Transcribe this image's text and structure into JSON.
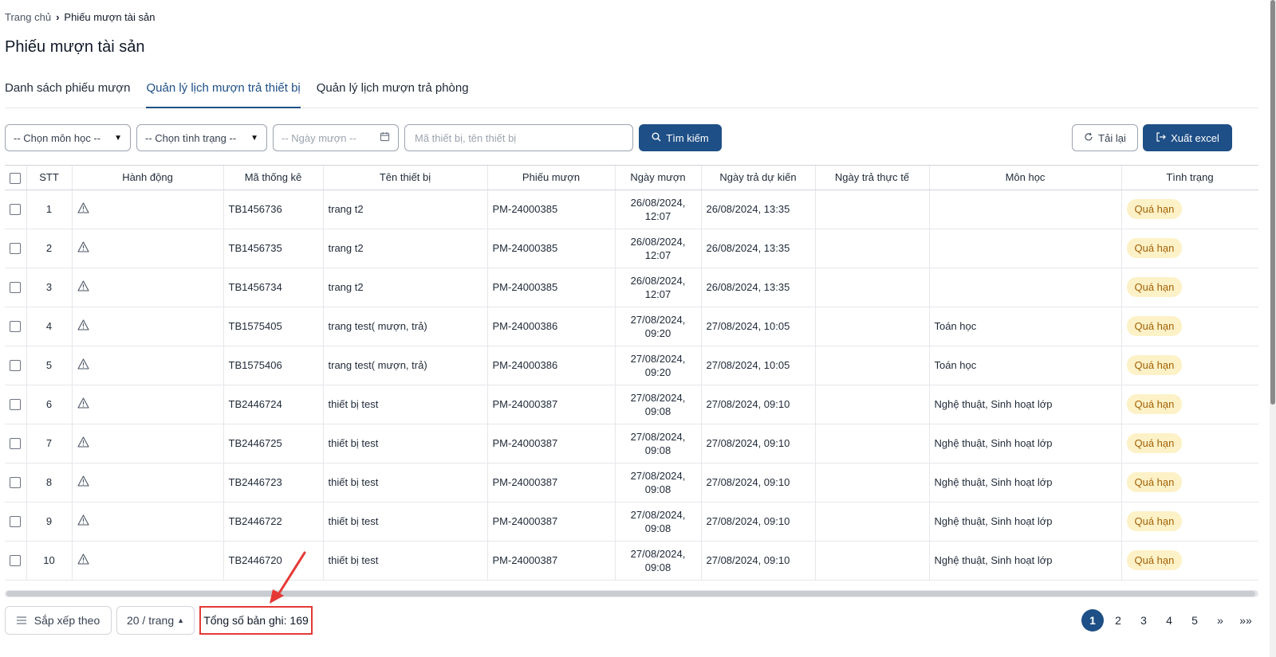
{
  "breadcrumb": {
    "home": "Trang chủ",
    "current": "Phiếu mượn tài sản"
  },
  "page_title": "Phiếu mượn tài sản",
  "tabs": [
    {
      "label": "Danh sách phiếu mượn",
      "active": false
    },
    {
      "label": "Quản lý lịch mượn trả thiết bị",
      "active": true
    },
    {
      "label": "Quản lý lịch mượn trả phòng",
      "active": false
    }
  ],
  "filters": {
    "subject": "-- Chọn môn học --",
    "status": "-- Chọn tình trạng --",
    "date_placeholder": "-- Ngày mượn --",
    "search_placeholder": "Mã thiết bị, tên thiết bị",
    "search_button": "Tìm kiếm",
    "reload_button": "Tải lại",
    "export_button": "Xuất excel"
  },
  "table": {
    "columns": [
      "STT",
      "Hành động",
      "Mã thống kê",
      "Tên thiết bị",
      "Phiếu mượn",
      "Ngày mượn",
      "Ngày trả dự kiến",
      "Ngày trả thực tế",
      "Môn học",
      "Tình trạng"
    ],
    "rows": [
      {
        "stt": "1",
        "code": "TB1456736",
        "name": "trang t2",
        "ticket": "PM-24000385",
        "borrow_date": "26/08/2024,",
        "borrow_time": "12:07",
        "due": "26/08/2024, 13:35",
        "returned": "",
        "subject": "",
        "status": "Quá hạn"
      },
      {
        "stt": "2",
        "code": "TB1456735",
        "name": "trang t2",
        "ticket": "PM-24000385",
        "borrow_date": "26/08/2024,",
        "borrow_time": "12:07",
        "due": "26/08/2024, 13:35",
        "returned": "",
        "subject": "",
        "status": "Quá hạn"
      },
      {
        "stt": "3",
        "code": "TB1456734",
        "name": "trang t2",
        "ticket": "PM-24000385",
        "borrow_date": "26/08/2024,",
        "borrow_time": "12:07",
        "due": "26/08/2024, 13:35",
        "returned": "",
        "subject": "",
        "status": "Quá hạn"
      },
      {
        "stt": "4",
        "code": "TB1575405",
        "name": "trang test( mượn, trả)",
        "ticket": "PM-24000386",
        "borrow_date": "27/08/2024,",
        "borrow_time": "09:20",
        "due": "27/08/2024, 10:05",
        "returned": "",
        "subject": "Toán học",
        "status": "Quá hạn"
      },
      {
        "stt": "5",
        "code": "TB1575406",
        "name": "trang test( mượn, trả)",
        "ticket": "PM-24000386",
        "borrow_date": "27/08/2024,",
        "borrow_time": "09:20",
        "due": "27/08/2024, 10:05",
        "returned": "",
        "subject": "Toán học",
        "status": "Quá hạn"
      },
      {
        "stt": "6",
        "code": "TB2446724",
        "name": "thiết bị test",
        "ticket": "PM-24000387",
        "borrow_date": "27/08/2024,",
        "borrow_time": "09:08",
        "due": "27/08/2024, 09:10",
        "returned": "",
        "subject": "Nghệ thuật, Sinh hoạt lớp",
        "status": "Quá hạn"
      },
      {
        "stt": "7",
        "code": "TB2446725",
        "name": "thiết bị test",
        "ticket": "PM-24000387",
        "borrow_date": "27/08/2024,",
        "borrow_time": "09:08",
        "due": "27/08/2024, 09:10",
        "returned": "",
        "subject": "Nghệ thuật, Sinh hoạt lớp",
        "status": "Quá hạn"
      },
      {
        "stt": "8",
        "code": "TB2446723",
        "name": "thiết bị test",
        "ticket": "PM-24000387",
        "borrow_date": "27/08/2024,",
        "borrow_time": "09:08",
        "due": "27/08/2024, 09:10",
        "returned": "",
        "subject": "Nghệ thuật, Sinh hoạt lớp",
        "status": "Quá hạn"
      },
      {
        "stt": "9",
        "code": "TB2446722",
        "name": "thiết bị test",
        "ticket": "PM-24000387",
        "borrow_date": "27/08/2024,",
        "borrow_time": "09:08",
        "due": "27/08/2024, 09:10",
        "returned": "",
        "subject": "Nghệ thuật, Sinh hoạt lớp",
        "status": "Quá hạn"
      },
      {
        "stt": "10",
        "code": "TB2446720",
        "name": "thiết bị test",
        "ticket": "PM-24000387",
        "borrow_date": "27/08/2024,",
        "borrow_time": "09:08",
        "due": "27/08/2024, 09:10",
        "returned": "",
        "subject": "Nghệ thuật, Sinh hoạt lớp",
        "status": "Quá hạn"
      }
    ]
  },
  "footer": {
    "sort_label": "Sắp xếp theo",
    "page_size": "20 / trang",
    "total": "Tổng số bản ghi: 169",
    "pages": [
      "1",
      "2",
      "3",
      "4",
      "5"
    ],
    "next": "»",
    "last": "»»"
  },
  "colors": {
    "primary": "#1e4f86",
    "badge_bg": "#fdf1c7",
    "badge_text": "#a16207",
    "annotation": "#e53935"
  },
  "icons": {
    "action": "warning-triangle-icon",
    "search": "search-icon",
    "reload": "refresh-icon",
    "export": "export-icon",
    "calendar": "calendar-icon",
    "sort": "menu-lines-icon"
  }
}
